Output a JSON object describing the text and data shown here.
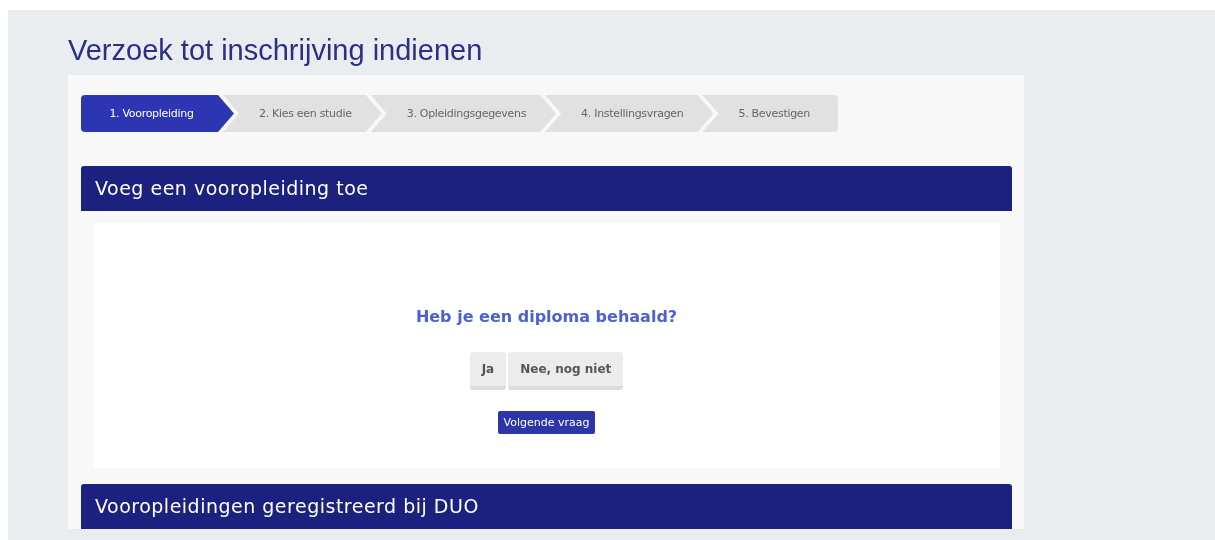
{
  "page_title": "Verzoek tot inschrijving indienen",
  "steps": [
    {
      "label": "1. Vooropleiding",
      "selected": true
    },
    {
      "label": "2. Kies een studie",
      "selected": false
    },
    {
      "label": "3. Opleidingsgegevens",
      "selected": false
    },
    {
      "label": "4. Instellingsvragen",
      "selected": false
    },
    {
      "label": "5. Bevestigen",
      "selected": false
    }
  ],
  "panels": [
    {
      "title": "Voeg een vooropleiding toe",
      "question": "Heb je een diploma behaald?",
      "choices": [
        {
          "label": "Ja",
          "selected": false
        },
        {
          "label": "Nee, nog niet",
          "selected": false
        }
      ],
      "next_button": "Volgende vraag"
    },
    {
      "title": "Vooropleidingen geregistreerd bij DUO"
    }
  ]
}
